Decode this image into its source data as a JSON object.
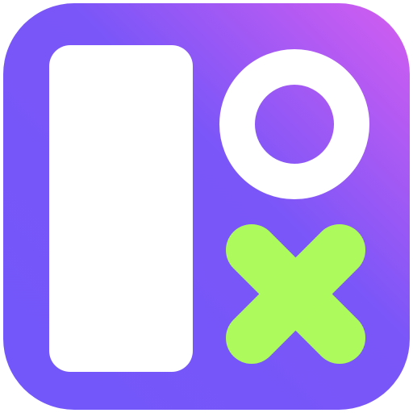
{
  "app_icon": {
    "icon": "tic-tac-toe-app-icon",
    "colors": {
      "background_gradient_start": "#7257FA",
      "background_gradient_mid": "#7A56F8",
      "background_gradient_end": "#D55DF0",
      "panel": "#FFFFFF",
      "ring": "#FFFFFF",
      "cross": "#ADFA5C"
    },
    "glyphs": {
      "panel": "rounded-rectangle-panel",
      "o_mark": "circle-o-icon",
      "x_mark": "cross-x-icon"
    }
  }
}
